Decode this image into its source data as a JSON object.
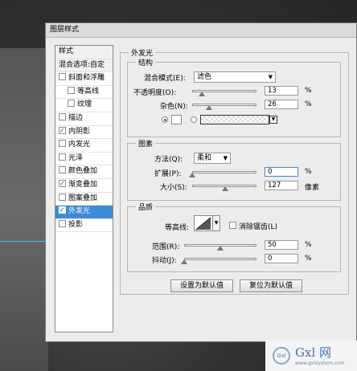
{
  "dialog": {
    "title": "图层样式"
  },
  "left_panel": {
    "items": [
      {
        "label": "样式",
        "type": "head"
      },
      {
        "label": "混合选项:自定",
        "type": "head"
      },
      {
        "label": "斜面和浮雕",
        "checked": false
      },
      {
        "label": "等高线",
        "checked": false,
        "indent": true
      },
      {
        "label": "纹理",
        "checked": false,
        "indent": true
      },
      {
        "label": "描边",
        "checked": false
      },
      {
        "label": "内阴影",
        "checked": true
      },
      {
        "label": "内发光",
        "checked": false
      },
      {
        "label": "光泽",
        "checked": false
      },
      {
        "label": "颜色叠加",
        "checked": false
      },
      {
        "label": "渐变叠加",
        "checked": true
      },
      {
        "label": "图案叠加",
        "checked": false
      },
      {
        "label": "外发光",
        "checked": true,
        "selected": true
      },
      {
        "label": "投影",
        "checked": false
      }
    ]
  },
  "outer_glow": {
    "section_title": "外发光",
    "structure": {
      "title": "结构",
      "blend_mode_label": "混合模式(E):",
      "blend_mode_value": "滤色",
      "opacity_label": "不透明度(O):",
      "opacity_value": "13",
      "opacity_unit": "%",
      "noise_label": "杂色(N):",
      "noise_value": "26",
      "noise_unit": "%"
    },
    "elements": {
      "title": "图素",
      "technique_label": "方法(Q):",
      "technique_value": "柔和",
      "spread_label": "扩展(P):",
      "spread_value": "0",
      "spread_unit": "%",
      "size_label": "大小(S):",
      "size_value": "127",
      "size_unit": "像素"
    },
    "quality": {
      "title": "品质",
      "contour_label": "等高线:",
      "antialias_label": "消除锯齿(L)",
      "antialias_checked": false,
      "range_label": "范围(R):",
      "range_value": "50",
      "range_unit": "%",
      "jitter_label": "抖动(J):",
      "jitter_value": "0",
      "jitter_unit": "%"
    },
    "buttons": {
      "make_default": "设置为默认值",
      "reset_default": "复位为默认值"
    }
  },
  "watermark": {
    "brand": "Gxl 网",
    "url": "www.gxlsystem.com",
    "logo_text": "Gxl"
  },
  "colors": {
    "selected": "#3c8bd9",
    "guide_line": "#4cc7e6"
  }
}
